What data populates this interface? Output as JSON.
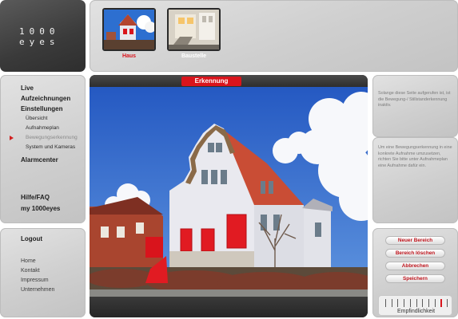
{
  "logo": {
    "line1": "1000",
    "line2": "eyes"
  },
  "thumbnails": [
    {
      "label": "Haus",
      "color": "#d9141c"
    },
    {
      "label": "Baustelle",
      "color": "#ffffff"
    }
  ],
  "nav": {
    "items": [
      {
        "label": "Live"
      },
      {
        "label": "Aufzeichnungen"
      },
      {
        "label": "Einstellungen"
      }
    ],
    "sub_items": [
      {
        "label": "Übersicht"
      },
      {
        "label": "Aufnahmeplan"
      },
      {
        "label": "Bewegungserkennung",
        "active": true
      },
      {
        "label": "System und Kameras"
      }
    ],
    "alarmcenter": "Alarmcenter",
    "help": "Hilfe/FAQ",
    "account": "my 1000eyes"
  },
  "footer": {
    "logout": "Logout",
    "links": [
      "Home",
      "Kontakt",
      "Impressum",
      "Unternehmen"
    ]
  },
  "main": {
    "tab_label": "Erkennung"
  },
  "info": {
    "text1": "Solange diese Seite aufgerufen ist, ist die Bewegung-/ Stillstanderkennung inaktiv.",
    "text2": "Um eine Bewegungserkennung in eine konkrete Aufnahme umzusetzen, richten Sie bitte unter Aufnahmeplan eine Aufnahme dafür ein."
  },
  "controls": {
    "new_area": "Neuer Bereich",
    "delete_area": "Bereich löschen",
    "cancel": "Abbrechen",
    "save": "Speichern",
    "sensitivity_label": "Empfindlichkeit",
    "sensitivity_level": 0.85
  },
  "colors": {
    "accent": "#d9141c"
  }
}
